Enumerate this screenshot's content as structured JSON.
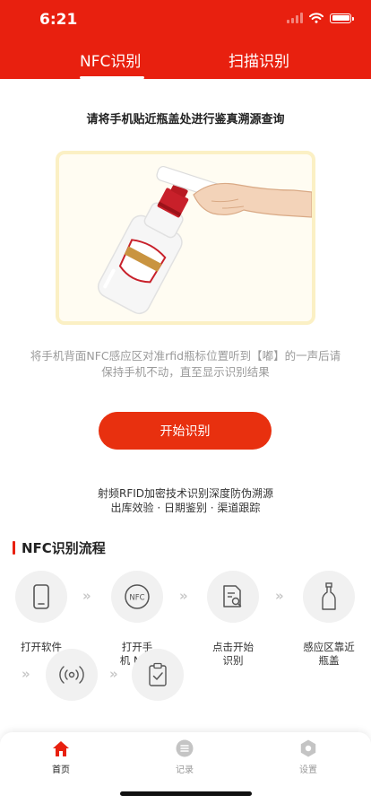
{
  "status_bar": {
    "time": "6:21"
  },
  "tabs": [
    {
      "label": "NFC识别",
      "active": true
    },
    {
      "label": "扫描识别",
      "active": false
    }
  ],
  "instruction": "请将手机贴近瓶盖处进行鉴真溯源查询",
  "description_lines": [
    "将手机背面NFC感应区对准rfid瓶标位置听到【嘟】的一声后请",
    "保持手机不动，直至显示识别结果"
  ],
  "start_button": "开始识别",
  "features": [
    "射频RFID加密技术识别深度防伪溯源",
    "出库效验 · 日期鉴别 · 渠道跟踪"
  ],
  "process": {
    "title": "NFC识别流程",
    "steps": [
      {
        "icon": "phone-icon",
        "label_lines": [
          "打开软件"
        ]
      },
      {
        "icon": "nfc-icon",
        "label_lines": [
          "打开手",
          "机 NFC"
        ]
      },
      {
        "icon": "document-search-icon",
        "label_lines": [
          "点击开始",
          "识别"
        ]
      },
      {
        "icon": "bottle-icon",
        "label_lines": [
          "感应区靠近",
          "瓶盖"
        ]
      },
      {
        "icon": "signal-icon",
        "label_lines": []
      },
      {
        "icon": "clipboard-check-icon",
        "label_lines": []
      }
    ]
  },
  "bottom_nav": [
    {
      "label": "首页",
      "icon": "home-icon",
      "active": true
    },
    {
      "label": "记录",
      "icon": "list-icon",
      "active": false
    },
    {
      "label": "设置",
      "icon": "settings-icon",
      "active": false
    }
  ],
  "colors": {
    "primary": "#e8200f",
    "button": "#e8300f",
    "illustration_border": "#fbf0c4"
  }
}
